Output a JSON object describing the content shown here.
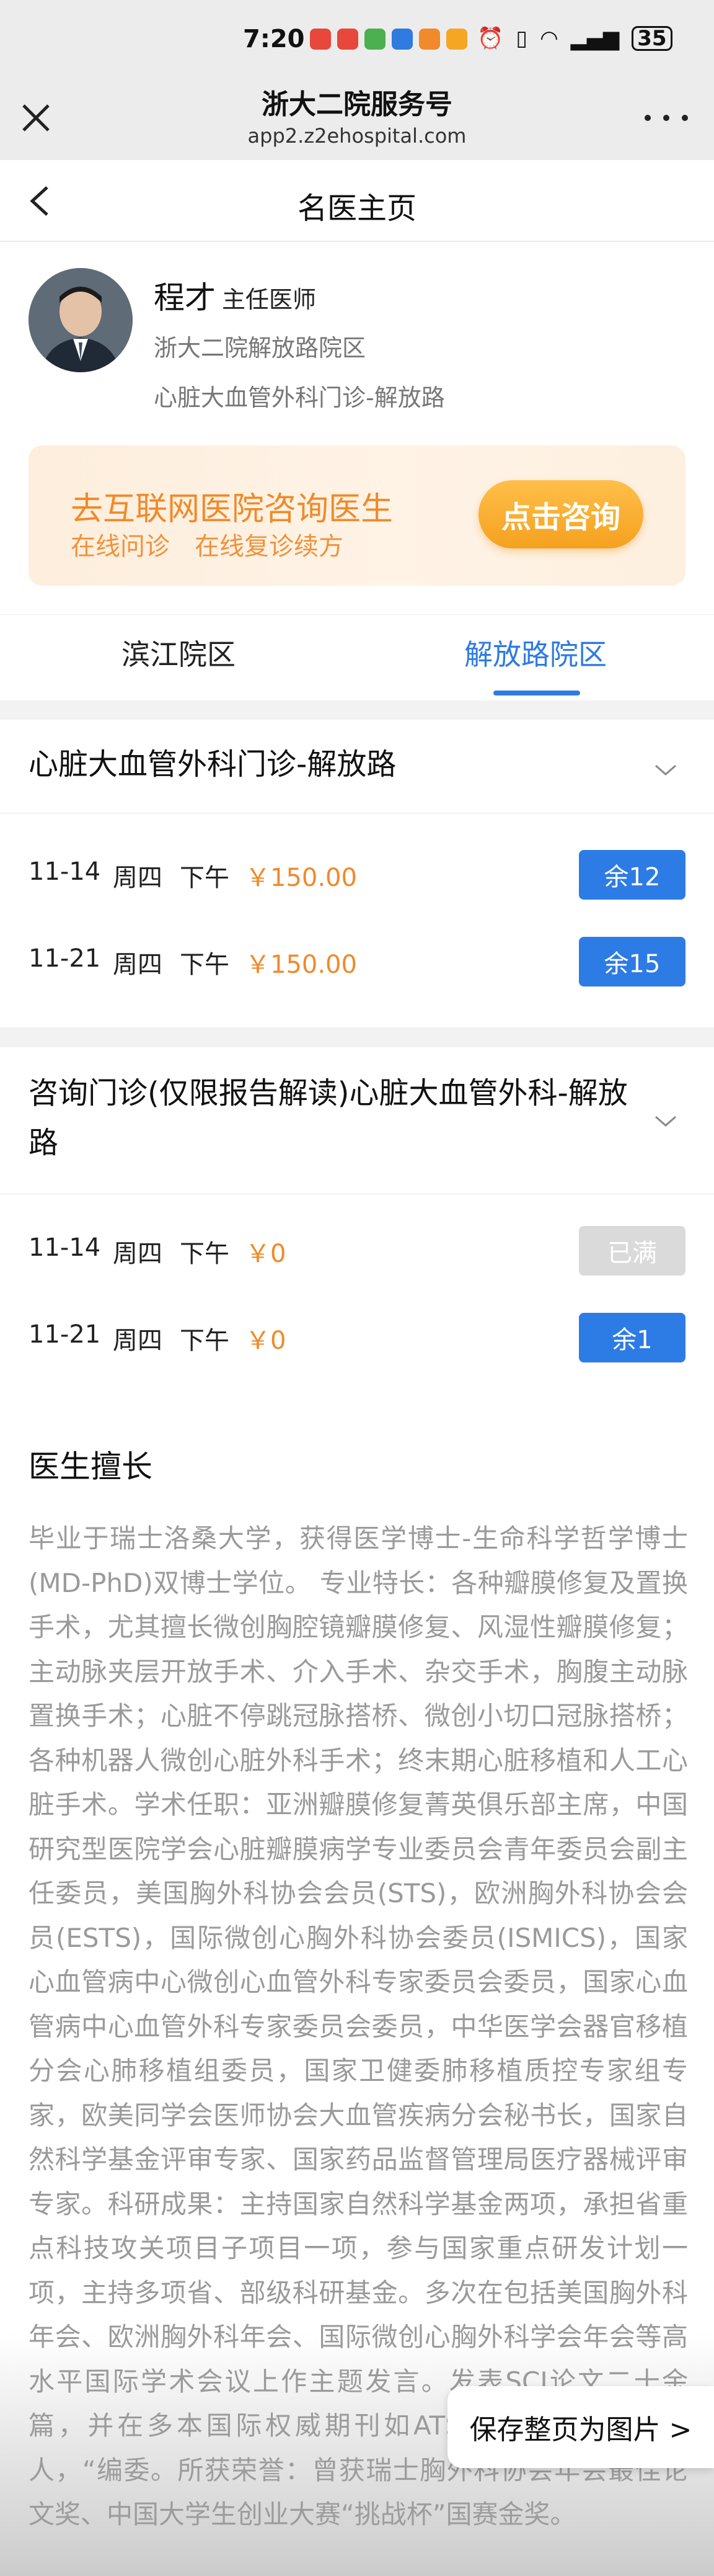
{
  "status_bar": {
    "time": "7:20",
    "battery": "35"
  },
  "mini_header": {
    "title": "浙大二院服务号",
    "url": "app2.z2ehospital.com"
  },
  "nav": {
    "title": "名医主页"
  },
  "doctor": {
    "name": "程才",
    "title": "主任医师",
    "hospital": "浙大二院解放路院区",
    "department": "心脏大血管外科门诊-解放路"
  },
  "consult": {
    "title": "去互联网医院咨询医生",
    "subtitle": "在线问诊　在线复诊续方",
    "button": "点击咨询"
  },
  "tabs": [
    {
      "label": "滨江院区",
      "active": false
    },
    {
      "label": "解放路院区",
      "active": true
    }
  ],
  "clinics": [
    {
      "name": "心脏大血管外科门诊-解放路",
      "slots": [
        {
          "date": "11-14",
          "weekday": "周四",
          "period": "下午",
          "price": "￥150.00",
          "status": "余12",
          "available": true
        },
        {
          "date": "11-21",
          "weekday": "周四",
          "period": "下午",
          "price": "￥150.00",
          "status": "余15",
          "available": true
        }
      ]
    },
    {
      "name_line1": "咨询门诊(仅限报告解读)心脏大血管外科-解放",
      "name_line2": "路",
      "slots": [
        {
          "date": "11-14",
          "weekday": "周四",
          "period": "下午",
          "price": "￥0",
          "status": "已满",
          "available": false
        },
        {
          "date": "11-21",
          "weekday": "周四",
          "period": "下午",
          "price": "￥0",
          "status": "余1",
          "available": true
        }
      ]
    }
  ],
  "expertise": {
    "title": "医生擅长",
    "body": "毕业于瑞士洛桑大学，获得医学博士-生命科学哲学博士(MD-PhD)双博士学位。 专业特长：各种瓣膜修复及置换手术，尤其擅长微创胸腔镜瓣膜修复、风湿性瓣膜修复；主动脉夹层开放手术、介入手术、杂交手术，胸腹主动脉置换手术；心脏不停跳冠脉搭桥、微创小切口冠脉搭桥；各种机器人微创心脏外科手术；终末期心脏移植和人工心脏手术。学术任职：亚洲瓣膜修复菁英俱乐部主席，中国研究型医院学会心脏瓣膜病学专业委员会青年委员会副主任委员，美国胸外科协会会员(STS)，欧洲胸外科协会会员(ESTS)，国际微创心胸外科协会委员(ISMICS)，国家心血管病中心微创心血管外科专家委员会委员，国家心血管病中心血管外科专家委员会委员，中华医学会器官移植分会心肺移植组委员，国家卫健委肺移植质控专家组专家，欧美同学会医师协会大血管疾病分会秘书长，国家自然科学基金评审专家、国家药品监督管理局医疗器械评审专家。科研成果：主持国家自然科学基金两项，承担省重点科技攻关项目子项目一项，参与国家重点研发计划一项，主持多项省、部级科研基金。多次在包括美国胸外科年会、欧洲胸外科年会、国际微创心胸外科学会年会等高水平国际学术会议上作主题发言。发表SCI论文二十余篇，并在多本国际权威期刊如ATS、EJCTS担任审稿人，“编委。所获荣誉：曾获瑞士胸外科协会年会最佳论文奖、中国大学生创业大赛“挑战杯”国赛金奖。"
  },
  "save_button": "保存整页为图片 >"
}
